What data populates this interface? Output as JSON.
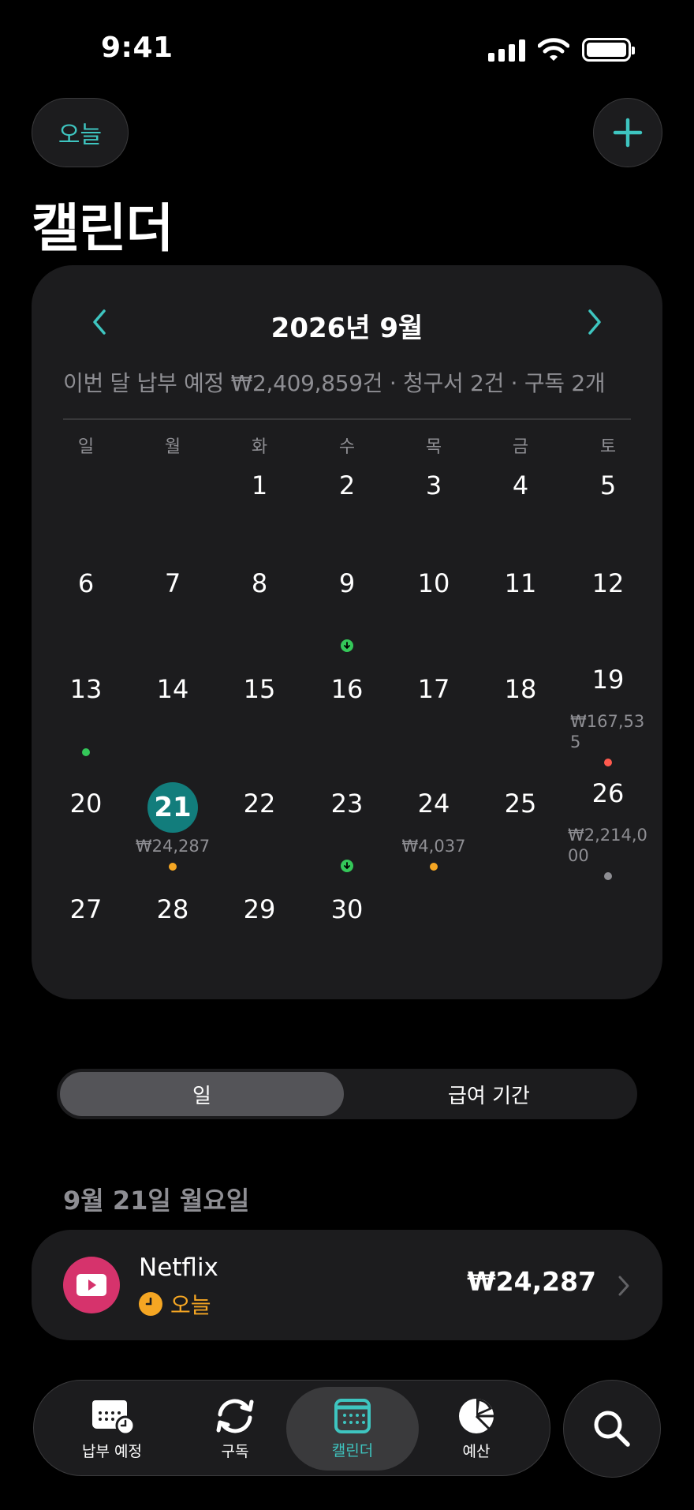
{
  "status_bar": {
    "time": "9:41"
  },
  "header": {
    "today_label": "오늘",
    "title": "캘린더"
  },
  "calendar": {
    "month_title": "2026년 9월",
    "summary": "이번 달 납부 예정 ₩2,409,859건 · 청구서 2건 · 구독 2개",
    "weekdays": [
      "일",
      "월",
      "화",
      "수",
      "목",
      "금",
      "토"
    ],
    "today_day": "21",
    "days": {
      "d1": "1",
      "d2": "2",
      "d3": "3",
      "d4": "4",
      "d5": "5",
      "d6": "6",
      "d7": "7",
      "d8": "8",
      "d9": "9",
      "d10": "10",
      "d11": "11",
      "d12": "12",
      "d13": "13",
      "d14": "14",
      "d15": "15",
      "d16": "16",
      "d17": "17",
      "d18": "18",
      "d19": "19",
      "d20": "20",
      "d22": "22",
      "d23": "23",
      "d24": "24",
      "d25": "25",
      "d26": "26",
      "d27": "27",
      "d28": "28",
      "d29": "29",
      "d30": "30"
    },
    "amounts": {
      "d19_line1": "₩167,53",
      "d19_line2": "5",
      "d21": "₩24,287",
      "d24": "₩4,037",
      "d26_line1": "₩2,214,0",
      "d26_line2": "00"
    },
    "colors": {
      "income": "#34c759",
      "today": "#127d7c",
      "overdue": "#ff5a4e",
      "upcoming": "#f5a623",
      "neutral": "#8e8e93"
    }
  },
  "segmented": {
    "day_label": "일",
    "pay_period_label": "급여 기간"
  },
  "detail": {
    "date_heading": "9월 21일 월요일",
    "item": {
      "name": "Netflix",
      "status": "오늘",
      "amount": "₩24,287",
      "icon": "play-icon"
    }
  },
  "tab_bar": {
    "tabs": [
      {
        "label": "납부 예정",
        "icon": "calendar-clock-icon"
      },
      {
        "label": "구독",
        "icon": "refresh-icon"
      },
      {
        "label": "캘린더",
        "icon": "calendar-icon"
      },
      {
        "label": "예산",
        "icon": "pie-chart-icon"
      }
    ]
  }
}
